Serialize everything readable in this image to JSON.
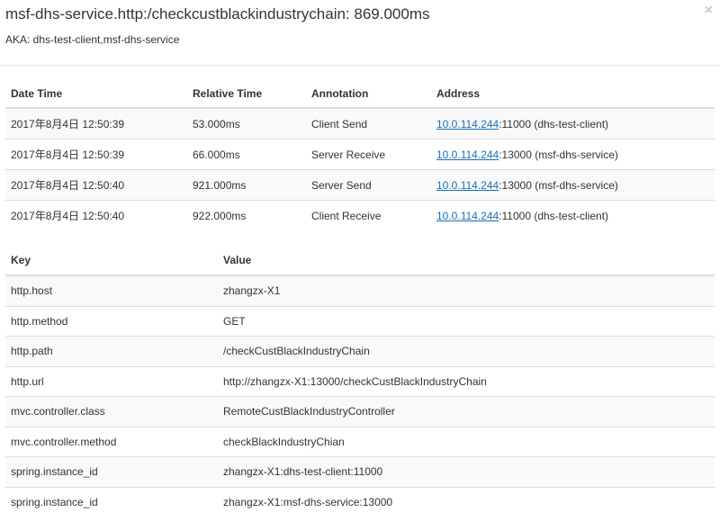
{
  "modal": {
    "title": "msf-dhs-service.http:/checkcustblackindustrychain: 869.000ms",
    "aka": "AKA: dhs-test-client,msf-dhs-service",
    "close_glyph": "×"
  },
  "annotations": {
    "headers": [
      "Date Time",
      "Relative Time",
      "Annotation",
      "Address"
    ],
    "rows": [
      {
        "date_time": "2017年8月4日 12:50:39",
        "relative_time": "53.000ms",
        "annotation": "Client Send",
        "ip": "10.0.114.244",
        "address_rest": ":11000 (dhs-test-client)"
      },
      {
        "date_time": "2017年8月4日 12:50:39",
        "relative_time": "66.000ms",
        "annotation": "Server Receive",
        "ip": "10.0.114.244",
        "address_rest": ":13000 (msf-dhs-service)"
      },
      {
        "date_time": "2017年8月4日 12:50:40",
        "relative_time": "921.000ms",
        "annotation": "Server Send",
        "ip": "10.0.114.244",
        "address_rest": ":13000 (msf-dhs-service)"
      },
      {
        "date_time": "2017年8月4日 12:50:40",
        "relative_time": "922.000ms",
        "annotation": "Client Receive",
        "ip": "10.0.114.244",
        "address_rest": ":11000 (dhs-test-client)"
      }
    ]
  },
  "binary_annotations": {
    "headers": [
      "Key",
      "Value"
    ],
    "rows": [
      {
        "key": "http.host",
        "value": "zhangzx-X1"
      },
      {
        "key": "http.method",
        "value": "GET"
      },
      {
        "key": "http.path",
        "value": "/checkCustBlackIndustryChain"
      },
      {
        "key": "http.url",
        "value": "http://zhangzx-X1:13000/checkCustBlackIndustryChain"
      },
      {
        "key": "mvc.controller.class",
        "value": "RemoteCustBlackIndustryController"
      },
      {
        "key": "mvc.controller.method",
        "value": "checkBlackIndustryChian"
      },
      {
        "key": "spring.instance_id",
        "value": "zhangzx-X1:dhs-test-client:11000"
      },
      {
        "key": "spring.instance_id",
        "value": "zhangzx-X1:msf-dhs-service:13000"
      }
    ]
  },
  "colors": {
    "link": "#1a6fb8",
    "stripe": "#f9f9f9",
    "border": "#dddddd",
    "text": "#333333"
  }
}
